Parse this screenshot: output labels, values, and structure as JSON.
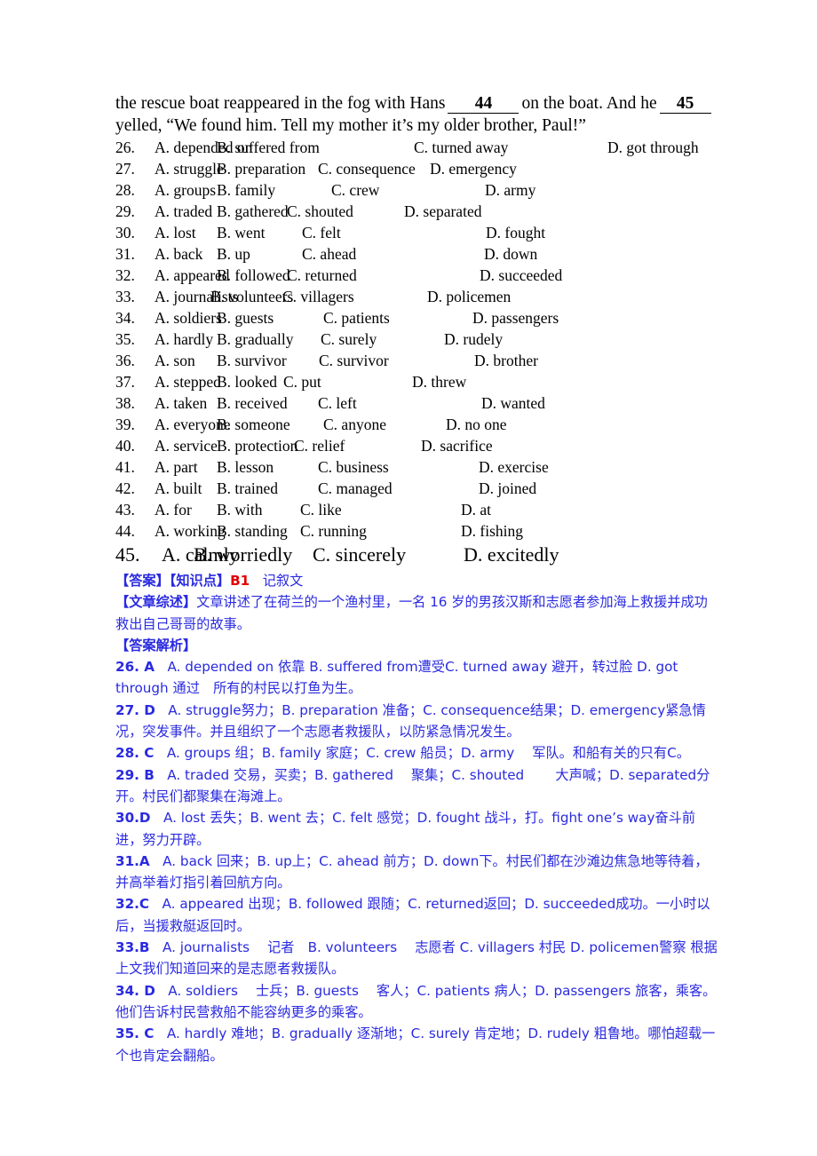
{
  "passage": {
    "line1_part1": "the rescue boat reappeared in the fog with Hans",
    "blank44": "44",
    "line1_part2": "on the boat. And he",
    "blank45": "45",
    "line2": "yelled, “We found him. Tell my mother it’s my older brother, Paul!”"
  },
  "questions": [
    {
      "num": "26.",
      "a": "A. depended on",
      "b": "B. suffered from",
      "c": "C. turned away",
      "d": "D. got through",
      "x": [
        0,
        70,
        292,
        510
      ]
    },
    {
      "num": "27.",
      "a": "A. struggle",
      "b": "B. preparation",
      "c": "C. consequence",
      "d": "D. emergency",
      "x": [
        0,
        70,
        184,
        310
      ]
    },
    {
      "num": "28.",
      "a": "A. groups",
      "b": "B. family",
      "c": "C. crew",
      "d": "D. army",
      "x": [
        0,
        70,
        199,
        372
      ]
    },
    {
      "num": "29.",
      "a": "A. traded",
      "b": "B. gathered",
      "c": "C. shouted",
      "d": "D. separated",
      "x": [
        0,
        70,
        149,
        281
      ]
    },
    {
      "num": "30.",
      "a": "A. lost",
      "b": "B. went",
      "c": "C. felt",
      "d": "D. fought",
      "x": [
        0,
        70,
        166,
        373
      ]
    },
    {
      "num": "31.",
      "a": "A. back",
      "b": "B. up",
      "c": "C. ahead",
      "d": "D. down",
      "x": [
        0,
        70,
        166,
        371
      ]
    },
    {
      "num": "32.",
      "a": "A. appeared",
      "b": "B. followed",
      "c": "C. returned",
      "d": "D. succeeded",
      "x": [
        0,
        70,
        149,
        366
      ]
    },
    {
      "num": "33.",
      "a": "A. journalists",
      "b": "B. volunteers",
      "c": "C. villagers",
      "d": "D. policemen",
      "x": [
        0,
        63,
        144,
        307
      ]
    },
    {
      "num": "34.",
      "a": "A. soldiers",
      "b": "B. guests",
      "c": "C. patients",
      "d": "D. passengers",
      "x": [
        0,
        70,
        190,
        358
      ]
    },
    {
      "num": "35.",
      "a": "A. hardly",
      "b": "B. gradually",
      "c": "C. surely",
      "d": "D. rudely",
      "x": [
        0,
        70,
        187,
        326
      ]
    },
    {
      "num": "36.",
      "a": "A. son",
      "b": "B. survivor",
      "c": "C. survivor",
      "d": "D. brother",
      "x": [
        0,
        70,
        185,
        360
      ]
    },
    {
      "num": "37.",
      "a": "A. stepped",
      "b": "B. looked",
      "c": "C. put",
      "d": "D. threw",
      "x": [
        0,
        70,
        145,
        290
      ]
    },
    {
      "num": "38.",
      "a": "A. taken",
      "b": "B. received",
      "c": "C. left",
      "d": "D. wanted",
      "x": [
        0,
        70,
        184,
        368
      ]
    },
    {
      "num": "39.",
      "a": "A. everyone",
      "b": "B. someone",
      "c": "C. anyone",
      "d": "D. no one",
      "x": [
        0,
        70,
        190,
        328
      ]
    },
    {
      "num": "40.",
      "a": "A. service",
      "b": "B. protection",
      "c": "C. relief",
      "d": "D. sacrifice",
      "x": [
        0,
        70,
        157,
        300
      ]
    },
    {
      "num": "41.",
      "a": "A. part",
      "b": "B. lesson",
      "c": "C. business",
      "d": "D. exercise",
      "x": [
        0,
        70,
        184,
        365
      ]
    },
    {
      "num": "42.",
      "a": "A. built",
      "b": "B. trained",
      "c": "C. managed",
      "d": "D. joined",
      "x": [
        0,
        70,
        184,
        365
      ]
    },
    {
      "num": "43.",
      "a": "A. for",
      "b": "B. with",
      "c": "C. like",
      "d": "D. at",
      "x": [
        0,
        70,
        164,
        345
      ]
    },
    {
      "num": "44.",
      "a": "A. working",
      "b": "B. standing",
      "c": "C. running",
      "d": "D. fishing",
      "x": [
        0,
        70,
        164,
        345
      ]
    }
  ],
  "question45": {
    "num": "45.",
    "a": "A. calmly",
    "b": "B. worriedly",
    "c": "C. sincerely",
    "d": "D. excitedly",
    "x": [
      0,
      36,
      170,
      340
    ]
  },
  "analysis": {
    "answer_tag": "【答案】【知识点】",
    "knowledge_code": "B1",
    "genre": "记叙文",
    "summary_tag": "【文章综述】",
    "summary_text": "文章讲述了在荷兰的一个渔村里，一名 16 岁的男孩汉斯和志愿者参加海上救援并成功救出自己哥哥的故事。",
    "explain_tag": "【答案解析】",
    "items": [
      {
        "label": "26. A",
        "text": "A. depended on 依靠 B. suffered from遭受C. turned away 避开，转过脸 D. got through 通过　所有的村民以打鱼为生。"
      },
      {
        "label": "27. D",
        "text": "A. struggle努力；B. preparation 准备；C. consequence结果；D. emergency紧急情况，突发事件。并且组织了一个志愿者救援队，以防紧急情况发生。"
      },
      {
        "label": "28. C",
        "text": "A. groups 组；B. family 家庭；C. crew 船员；D. army 　军队。和船有关的只有C。"
      },
      {
        "label": "29. B",
        "text": "A. traded 交易，买卖；B. gathered 　聚集；C. shouted 　　大声喊；D. separated分开。村民们都聚集在海滩上。"
      },
      {
        "label": "30.D",
        "text": "A. lost 丢失；B. went 去；C. felt 感觉；D. fought 战斗，打。fight one’s way奋斗前进，努力开辟。"
      },
      {
        "label": "31.A",
        "text": "A. back 回来；B. up上；C. ahead 前方；D. down下。村民们都在沙滩边焦急地等待着，并高举着灯指引着回航方向。"
      },
      {
        "label": "32.C",
        "text": "A. appeared 出现；B. followed 跟随；C. returned返回；D. succeeded成功。一小时以后，当援救艇返回时。"
      },
      {
        "label": "33.B",
        "text": "A. journalists 　记者　B. volunteers 　志愿者 C. villagers 村民 D. policemen警察 根据上文我们知道回来的是志愿者救援队。"
      },
      {
        "label": "34. D",
        "text": "A. soldiers 　士兵；B. guests 　客人；C. patients 病人；D. passengers 旅客，乘客。他们告诉村民营救船不能容纳更多的乘客。"
      },
      {
        "label": "35. C",
        "text": "A. hardly 难地；B. gradually 逐渐地；C. surely 肯定地；D. rudely 粗鲁地。哪怕超载一个也肯定会翻船。"
      }
    ]
  },
  "colors": {
    "text": "#000000",
    "analysis_blue": "#2a2ae0",
    "accent_red": "#e00000",
    "page_background": "#ffffff"
  }
}
